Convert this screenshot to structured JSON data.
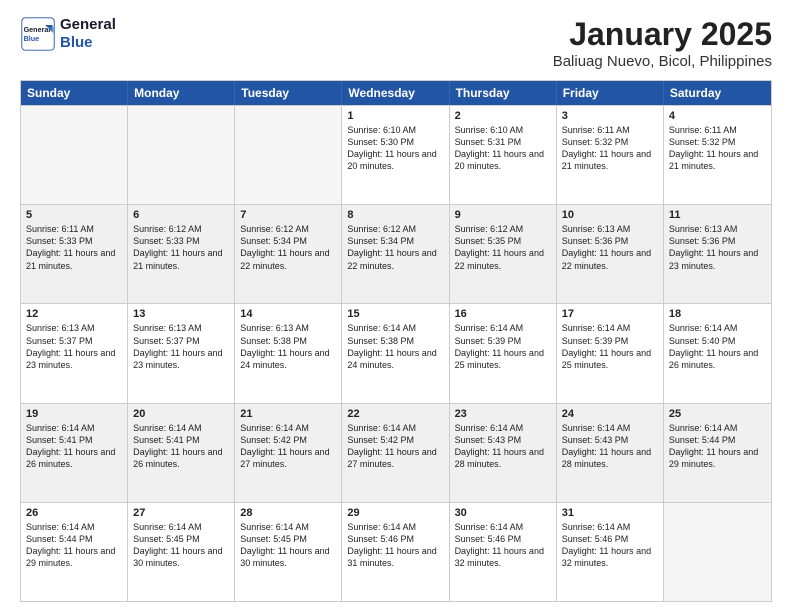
{
  "logo": {
    "line1": "General",
    "line2": "Blue"
  },
  "title": "January 2025",
  "subtitle": "Baliuag Nuevo, Bicol, Philippines",
  "days": [
    "Sunday",
    "Monday",
    "Tuesday",
    "Wednesday",
    "Thursday",
    "Friday",
    "Saturday"
  ],
  "rows": [
    [
      {
        "day": "",
        "empty": true
      },
      {
        "day": "",
        "empty": true
      },
      {
        "day": "",
        "empty": true
      },
      {
        "day": "1",
        "rise": "6:10 AM",
        "set": "5:30 PM",
        "daylight": "11 hours and 20 minutes."
      },
      {
        "day": "2",
        "rise": "6:10 AM",
        "set": "5:31 PM",
        "daylight": "11 hours and 20 minutes."
      },
      {
        "day": "3",
        "rise": "6:11 AM",
        "set": "5:32 PM",
        "daylight": "11 hours and 21 minutes."
      },
      {
        "day": "4",
        "rise": "6:11 AM",
        "set": "5:32 PM",
        "daylight": "11 hours and 21 minutes."
      }
    ],
    [
      {
        "day": "5",
        "rise": "6:11 AM",
        "set": "5:33 PM",
        "daylight": "11 hours and 21 minutes."
      },
      {
        "day": "6",
        "rise": "6:12 AM",
        "set": "5:33 PM",
        "daylight": "11 hours and 21 minutes."
      },
      {
        "day": "7",
        "rise": "6:12 AM",
        "set": "5:34 PM",
        "daylight": "11 hours and 22 minutes."
      },
      {
        "day": "8",
        "rise": "6:12 AM",
        "set": "5:34 PM",
        "daylight": "11 hours and 22 minutes."
      },
      {
        "day": "9",
        "rise": "6:12 AM",
        "set": "5:35 PM",
        "daylight": "11 hours and 22 minutes."
      },
      {
        "day": "10",
        "rise": "6:13 AM",
        "set": "5:36 PM",
        "daylight": "11 hours and 22 minutes."
      },
      {
        "day": "11",
        "rise": "6:13 AM",
        "set": "5:36 PM",
        "daylight": "11 hours and 23 minutes."
      }
    ],
    [
      {
        "day": "12",
        "rise": "6:13 AM",
        "set": "5:37 PM",
        "daylight": "11 hours and 23 minutes."
      },
      {
        "day": "13",
        "rise": "6:13 AM",
        "set": "5:37 PM",
        "daylight": "11 hours and 23 minutes."
      },
      {
        "day": "14",
        "rise": "6:13 AM",
        "set": "5:38 PM",
        "daylight": "11 hours and 24 minutes."
      },
      {
        "day": "15",
        "rise": "6:14 AM",
        "set": "5:38 PM",
        "daylight": "11 hours and 24 minutes."
      },
      {
        "day": "16",
        "rise": "6:14 AM",
        "set": "5:39 PM",
        "daylight": "11 hours and 25 minutes."
      },
      {
        "day": "17",
        "rise": "6:14 AM",
        "set": "5:39 PM",
        "daylight": "11 hours and 25 minutes."
      },
      {
        "day": "18",
        "rise": "6:14 AM",
        "set": "5:40 PM",
        "daylight": "11 hours and 26 minutes."
      }
    ],
    [
      {
        "day": "19",
        "rise": "6:14 AM",
        "set": "5:41 PM",
        "daylight": "11 hours and 26 minutes."
      },
      {
        "day": "20",
        "rise": "6:14 AM",
        "set": "5:41 PM",
        "daylight": "11 hours and 26 minutes."
      },
      {
        "day": "21",
        "rise": "6:14 AM",
        "set": "5:42 PM",
        "daylight": "11 hours and 27 minutes."
      },
      {
        "day": "22",
        "rise": "6:14 AM",
        "set": "5:42 PM",
        "daylight": "11 hours and 27 minutes."
      },
      {
        "day": "23",
        "rise": "6:14 AM",
        "set": "5:43 PM",
        "daylight": "11 hours and 28 minutes."
      },
      {
        "day": "24",
        "rise": "6:14 AM",
        "set": "5:43 PM",
        "daylight": "11 hours and 28 minutes."
      },
      {
        "day": "25",
        "rise": "6:14 AM",
        "set": "5:44 PM",
        "daylight": "11 hours and 29 minutes."
      }
    ],
    [
      {
        "day": "26",
        "rise": "6:14 AM",
        "set": "5:44 PM",
        "daylight": "11 hours and 29 minutes."
      },
      {
        "day": "27",
        "rise": "6:14 AM",
        "set": "5:45 PM",
        "daylight": "11 hours and 30 minutes."
      },
      {
        "day": "28",
        "rise": "6:14 AM",
        "set": "5:45 PM",
        "daylight": "11 hours and 30 minutes."
      },
      {
        "day": "29",
        "rise": "6:14 AM",
        "set": "5:46 PM",
        "daylight": "11 hours and 31 minutes."
      },
      {
        "day": "30",
        "rise": "6:14 AM",
        "set": "5:46 PM",
        "daylight": "11 hours and 32 minutes."
      },
      {
        "day": "31",
        "rise": "6:14 AM",
        "set": "5:46 PM",
        "daylight": "11 hours and 32 minutes."
      },
      {
        "day": "",
        "empty": true
      }
    ]
  ],
  "cell_labels": {
    "sunrise": "Sunrise:",
    "sunset": "Sunset:",
    "daylight": "Daylight:"
  }
}
